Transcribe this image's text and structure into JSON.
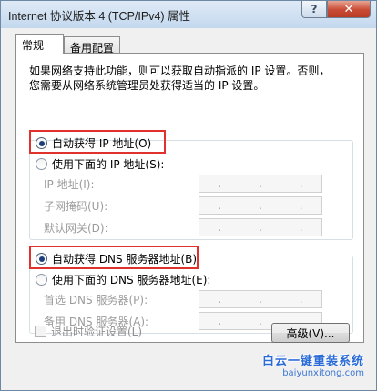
{
  "window": {
    "title": "Internet 协议版本 4 (TCP/IPv4) 属性",
    "help_symbol": "?",
    "close_symbol": "✕"
  },
  "tabs": [
    {
      "label": "常规",
      "active": true
    },
    {
      "label": "备用配置",
      "active": false
    }
  ],
  "general": {
    "intro_line1": "如果网络支持此功能，则可以获取自动指派的 IP 设置。否则，",
    "intro_line2": "您需要从网络系统管理员处获得适当的 IP 设置。",
    "ip_auto_label": "自动获得 IP 地址(O)",
    "ip_manual_label": "使用下面的 IP 地址(S):",
    "ip_address_label": "IP 地址(I):",
    "subnet_label": "子网掩码(U):",
    "gateway_label": "默认网关(D):",
    "dns_auto_label": "自动获得 DNS 服务器地址(B)",
    "dns_manual_label": "使用下面的 DNS 服务器地址(E):",
    "dns_preferred_label": "首选 DNS 服务器(P):",
    "dns_alternate_label": "备用 DNS 服务器(A):",
    "ip_auto_selected": true,
    "dns_auto_selected": true,
    "validate_label": "退出时验证设置(L)",
    "validate_checked": false,
    "advanced_button": "高级(V)..."
  },
  "watermark": {
    "main": "白云一键重装系统",
    "sub": "baiyunxitong.com"
  },
  "colors": {
    "highlight": "#e0312c",
    "disabled_text": "#9c9c9c"
  }
}
